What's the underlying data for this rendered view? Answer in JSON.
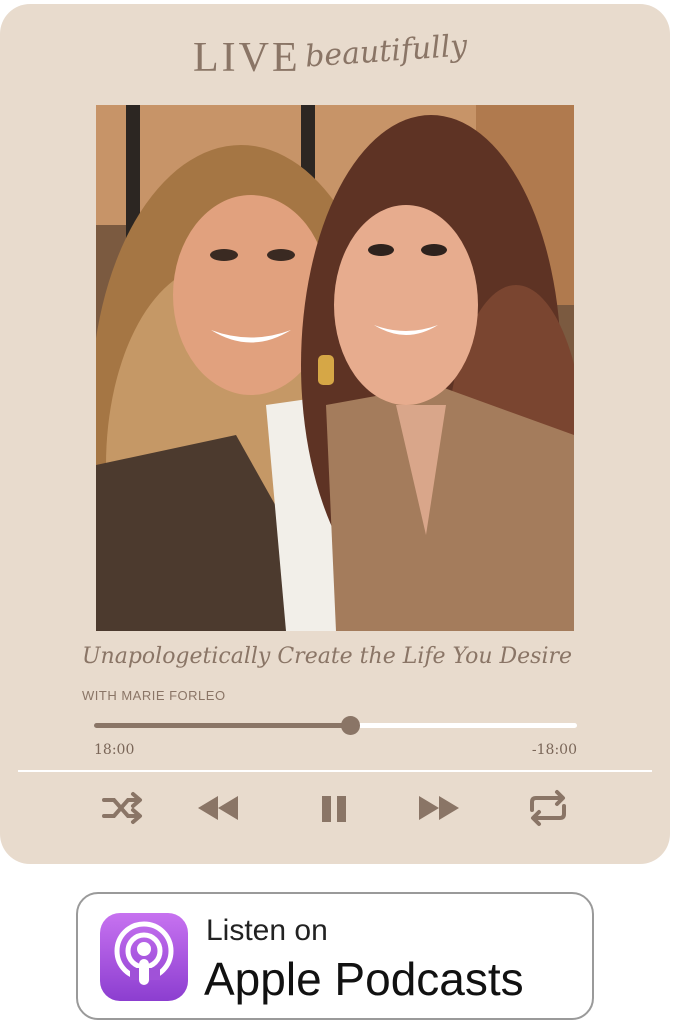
{
  "brand": {
    "primary": "LIVE",
    "script": "beautifully"
  },
  "episode": {
    "title": "Unapologetically Create the Life You Desire",
    "host": "WITH MARIE FORLEO"
  },
  "player": {
    "elapsed": "18:00",
    "remaining": "-18:00",
    "progress_fraction": 0.53,
    "controls": [
      {
        "name": "shuffle-icon"
      },
      {
        "name": "rewind-icon"
      },
      {
        "name": "pause-icon"
      },
      {
        "name": "fast-forward-icon"
      },
      {
        "name": "repeat-icon"
      }
    ]
  },
  "badge": {
    "line1": "Listen on",
    "line2": "Apple Podcasts",
    "icon": "apple-podcasts-icon"
  },
  "colors": {
    "card_bg": "#e8dbcd",
    "accent": "#8a7566",
    "podcasts_purple": "#9b4fdc"
  }
}
